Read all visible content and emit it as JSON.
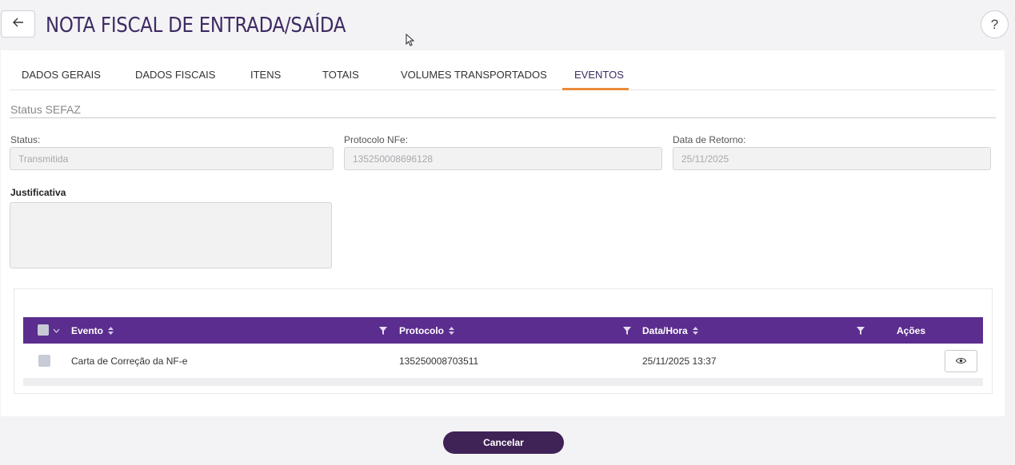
{
  "header": {
    "title": "NOTA FISCAL DE ENTRADA/SAÍDA",
    "help_label": "?"
  },
  "tabs": [
    {
      "label": "DADOS GERAIS",
      "active": false
    },
    {
      "label": "DADOS FISCAIS",
      "active": false
    },
    {
      "label": "ITENS",
      "active": false
    },
    {
      "label": "TOTAIS",
      "active": false
    },
    {
      "label": "VOLUMES TRANSPORTADOS",
      "active": false
    },
    {
      "label": "EVENTOS",
      "active": true
    }
  ],
  "sefaz": {
    "section_title": "Status SEFAZ",
    "status_label": "Status:",
    "status_value": "Transmitida",
    "protocolo_label": "Protocolo NFe:",
    "protocolo_value": "135250008696128",
    "data_retorno_label": "Data de Retorno:",
    "data_retorno_value": "25/11/2025",
    "justificativa_label": "Justificativa",
    "justificativa_value": ""
  },
  "events_table": {
    "columns": [
      "Evento",
      "Protocolo",
      "Data/Hora",
      "Ações"
    ],
    "rows": [
      {
        "evento": "Carta de Correção da NF-e",
        "protocolo": "135250008703511",
        "data_hora": "25/11/2025 13:37"
      }
    ]
  },
  "footer": {
    "cancel_label": "Cancelar"
  },
  "colors": {
    "accent_purple": "#5b2d8e",
    "title_purple": "#3f2b63",
    "tab_underline": "#e98b3a",
    "cancel_button": "#3f2256"
  }
}
